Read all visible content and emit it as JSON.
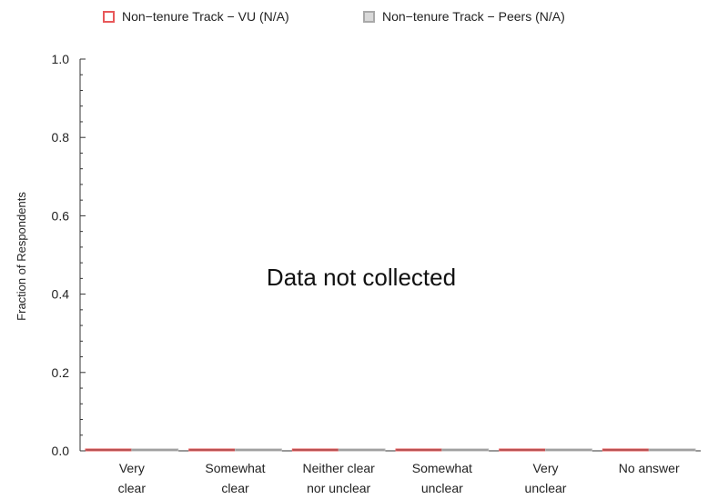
{
  "chart_data": {
    "type": "bar",
    "categories": [
      [
        "Very",
        "clear"
      ],
      [
        "Somewhat",
        "clear"
      ],
      [
        "Neither clear",
        "nor unclear"
      ],
      [
        "Somewhat",
        "unclear"
      ],
      [
        "Very",
        "unclear"
      ],
      [
        "No answer"
      ]
    ],
    "series": [
      {
        "name": "Non−tenure Track − VU (N/A)",
        "color": "#e8585a",
        "values": [
          0,
          0,
          0,
          0,
          0,
          0
        ]
      },
      {
        "name": "Non−tenure Track − Peers (N/A)",
        "color": "#b3b3b3",
        "values": [
          0,
          0,
          0,
          0,
          0,
          0
        ]
      }
    ],
    "ylabel": "Fraction of Respondents",
    "xlabel": "",
    "ylim": [
      0,
      1.0
    ],
    "yticks": [
      "0.0",
      "0.2",
      "0.4",
      "0.6",
      "0.8",
      "1.0"
    ],
    "annotation": "Data not collected",
    "legend_position": "top",
    "grid": false
  }
}
